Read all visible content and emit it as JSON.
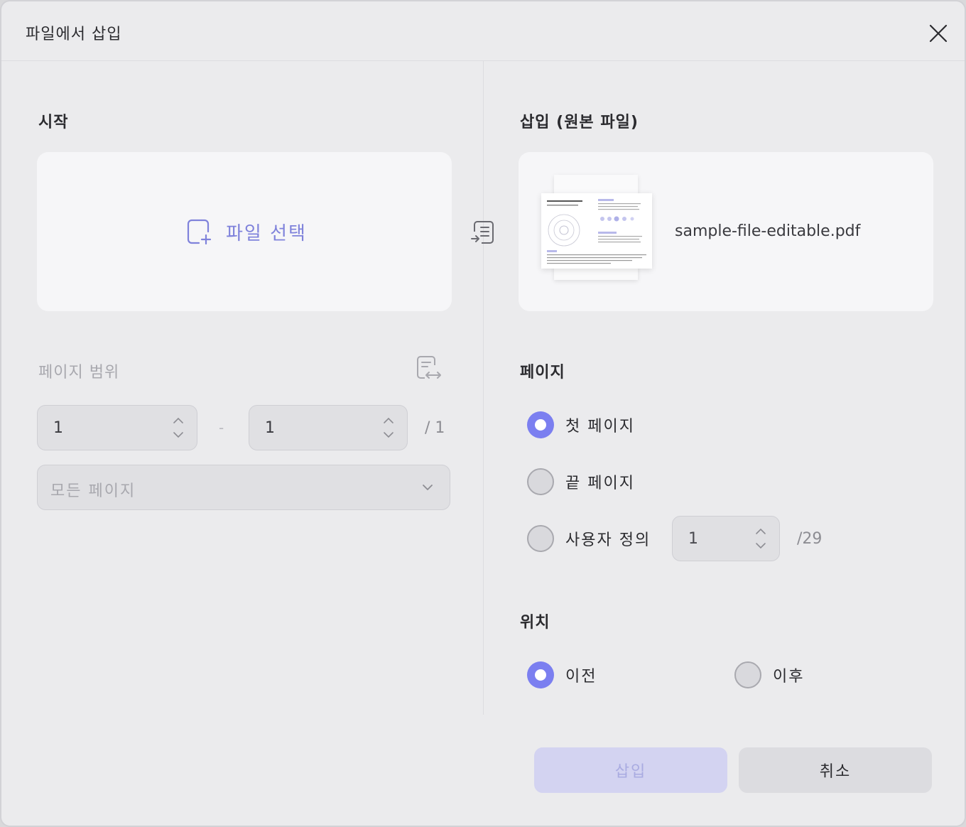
{
  "dialog": {
    "title": "파일에서 삽입"
  },
  "left": {
    "start_heading": "시작",
    "choose_file_label": "파일 선택",
    "page_range_heading": "페이지 범위",
    "range_from": "1",
    "range_separator": "-",
    "range_to": "1",
    "range_total": "/ 1",
    "page_filter": "모든 페이지"
  },
  "right": {
    "insert_heading": "삽입 (원본 파일)",
    "file_name": "sample-file-editable.pdf",
    "pages_heading": "페이지",
    "page_options": [
      {
        "label": "첫 페이지",
        "selected": true
      },
      {
        "label": "끝 페이지",
        "selected": false
      },
      {
        "label": "사용자 정의",
        "selected": false
      }
    ],
    "custom_page_value": "1",
    "custom_page_total": "/29",
    "position_heading": "위치",
    "position_options": [
      {
        "label": "이전",
        "selected": true
      },
      {
        "label": "이후",
        "selected": false
      }
    ]
  },
  "buttons": {
    "insert": "삽입",
    "cancel": "취소"
  },
  "colors": {
    "accent": "#7b7ff0",
    "accent_text": "#7f82db",
    "disabled_button": "#d3d3f1"
  }
}
